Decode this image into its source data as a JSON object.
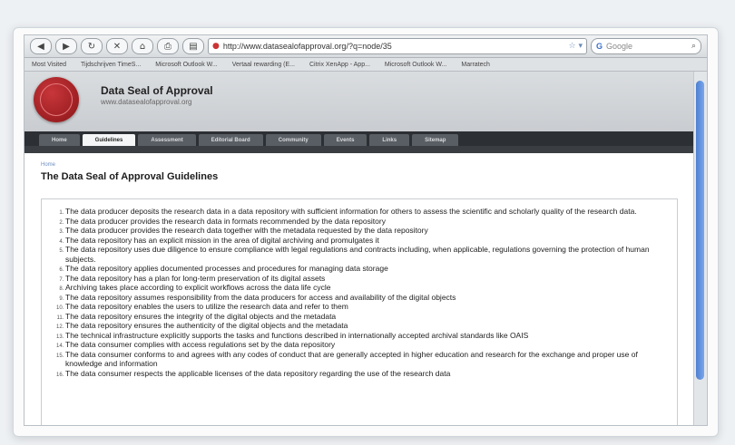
{
  "browser": {
    "url": "http://www.datasealofapproval.org/?q=node/35",
    "search_placeholder": "Google",
    "bookmarks": [
      "Most Visited",
      "Tijdschrijven TimeS...",
      "Microsoft Outlook W...",
      "Vertaal rewarding (E...",
      "Citrix XenApp - App...",
      "Microsoft Outlook W...",
      "Marratech"
    ]
  },
  "site": {
    "title": "Data Seal of Approval",
    "subtitle": "www.datasealofapproval.org",
    "nav": [
      "Home",
      "Guidelines",
      "Assessment",
      "Editorial Board",
      "Community",
      "Events",
      "Links",
      "Sitemap"
    ],
    "active_nav": "Guidelines"
  },
  "page": {
    "breadcrumb": "Home",
    "heading": "The Data Seal of Approval Guidelines",
    "guidelines": [
      "The data producer deposits the research data in a data repository with sufficient information for others to assess the scientific and scholarly quality of the research data.",
      "The data producer provides the research data in formats recommended by the data repository",
      "The data producer provides the research data together with the metadata requested by the data repository",
      "The data repository has an explicit mission in the area of digital archiving and promulgates it",
      "The data repository uses due diligence to ensure compliance with legal regulations and contracts including, when applicable, regulations governing the protection of human subjects.",
      "The data repository applies documented processes and procedures for managing data storage",
      "The data repository has a plan for long-term preservation of its digital assets",
      "Archiving takes place according to explicit workflows across the data life cycle",
      "The data repository assumes responsibility from the data producers for access and availability of the digital objects",
      "The data repository enables the users to utilize the research data and refer to them",
      "The data repository ensures the integrity of the digital objects and the metadata",
      "The data repository ensures the authenticity of the digital objects and the metadata",
      "The technical infrastructure explicitly supports the tasks and functions described in internationally accepted archival standards like OAIS",
      "The data consumer complies with access regulations set by the data repository",
      "The data consumer conforms to and agrees with any codes of conduct that are generally accepted in higher education and research for the exchange and proper use of knowledge and information",
      "The data consumer respects the applicable licenses of the data repository regarding the use of the research data"
    ]
  }
}
